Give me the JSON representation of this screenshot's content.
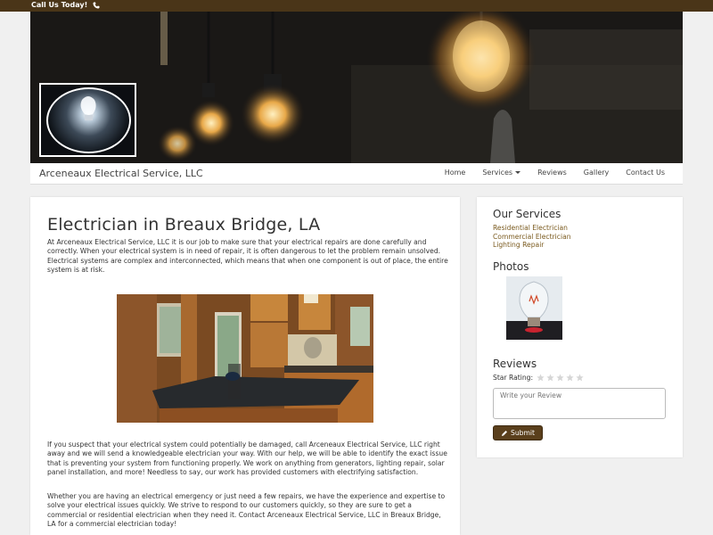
{
  "topbar": {
    "call_label": "Call Us Today!",
    "icon": "phone-icon"
  },
  "hero": {
    "logo_icon": "lightbulb-logo"
  },
  "navbar": {
    "brand": "Arceneaux Electrical Service, LLC",
    "items": [
      {
        "label": "Home"
      },
      {
        "label": "Services",
        "has_dropdown": true
      },
      {
        "label": "Reviews"
      },
      {
        "label": "Gallery"
      },
      {
        "label": "Contact Us"
      }
    ]
  },
  "main": {
    "title": "Electrician in Breaux Bridge, LA",
    "paragraph1": "At Arceneaux Electrical Service, LLC it is our job to make sure that your electrical repairs are done carefully and correctly. When your electrical system is in need of repair, it is often dangerous to let the problem remain unsolved. Electrical systems are complex and interconnected, which means that when one component is out of place, the entire system is at risk.",
    "paragraph2": "If you suspect that your electrical system could potentially be damaged, call Arceneaux Electrical Service, LLC right away and we will send a knowledgeable electrician your way. With our help, we will be able to identify the exact issue that is preventing your system from functioning properly. We work on anything from generators, lighting repair, solar panel installation, and more! Needless to say, our work has provided customers with electrifying satisfaction.",
    "paragraph3": "Whether you are having an electrical emergency or just need a few repairs, we have the experience and expertise to solve your electrical issues quickly. We strive to respond to our customers quickly, so they are sure to get a commercial or residential electrician when they need it. Contact Arceneaux Electrical Service, LLC in Breaux Bridge, LA for a commercial electrician today!"
  },
  "sidebar": {
    "services_heading": "Our Services",
    "services": [
      {
        "label": "Residential Electrician"
      },
      {
        "label": "Commercial Electrician"
      },
      {
        "label": "Lighting Repair"
      }
    ],
    "photos_heading": "Photos",
    "reviews_heading": "Reviews",
    "star_rating_label": "Star Rating:",
    "star_rating": 0,
    "star_count": 5,
    "review_placeholder": "Write your Review",
    "submit_label": "Submit",
    "submit_icon": "pencil-icon"
  },
  "colors": {
    "topbar": "#4a3518",
    "accent_link": "#7a5a1e",
    "button": "#5a3f1c"
  }
}
